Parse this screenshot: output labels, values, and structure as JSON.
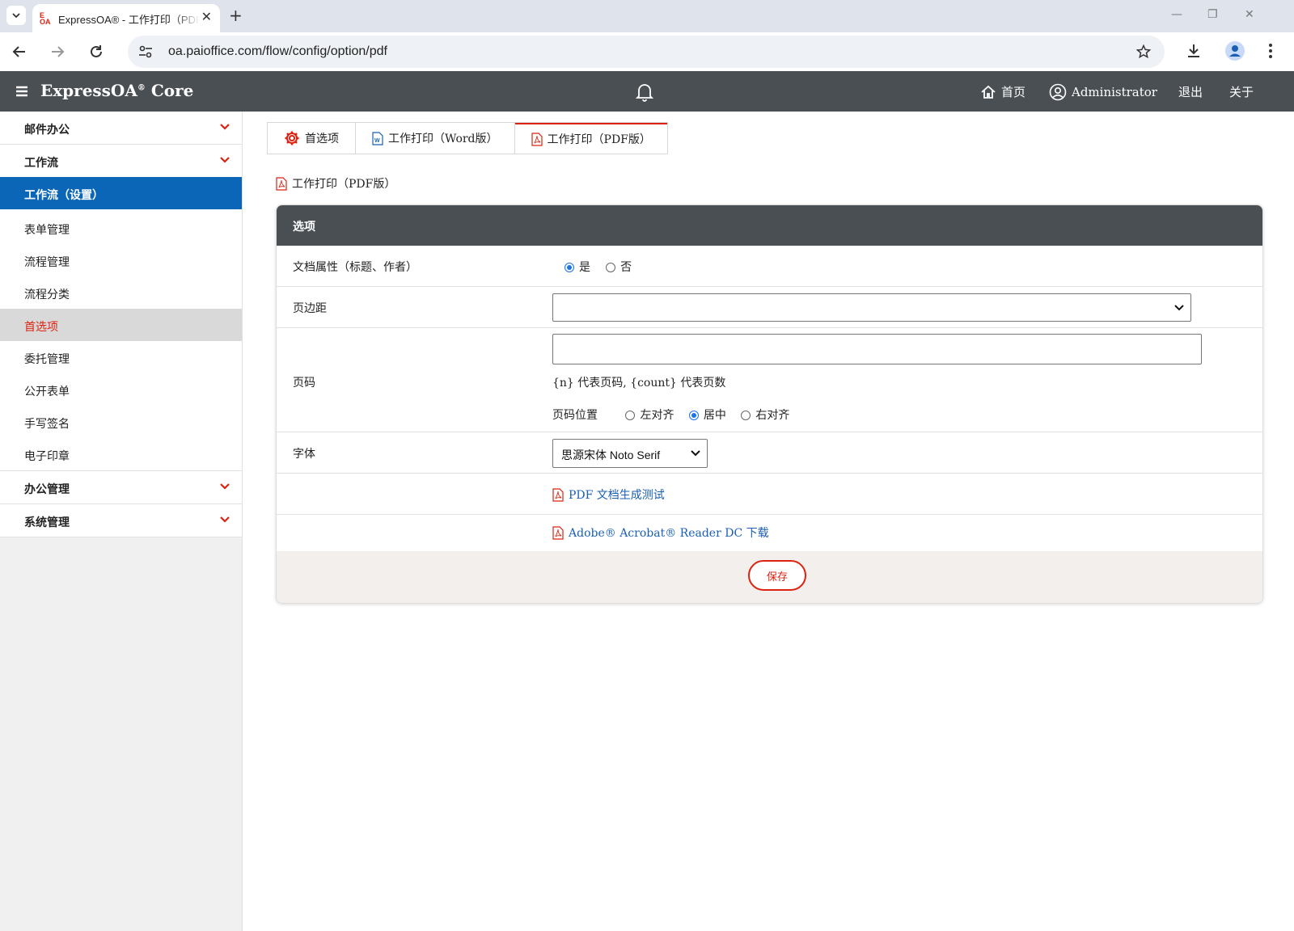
{
  "browser": {
    "tab_title": "ExpressOA® - 工作打印（PDF版）",
    "favicon_text": "E OA",
    "url": "oa.paioffice.com/flow/config/option/pdf"
  },
  "header": {
    "brand": "ExpressOA",
    "brand_sup": "®",
    "brand_suffix": " Core",
    "home": "首页",
    "user": "Administrator",
    "logout": "退出",
    "about": "关于"
  },
  "sidebar": {
    "group_mail": "邮件办公",
    "group_workflow": "工作流",
    "active": "工作流（设置）",
    "items": [
      "表单管理",
      "流程管理",
      "流程分类",
      "首选项",
      "委托管理",
      "公开表单",
      "手写签名",
      "电子印章"
    ],
    "current_index": 3,
    "group_office": "办公管理",
    "group_system": "系统管理"
  },
  "tabs": [
    "首选项",
    "工作打印（Word版）",
    "工作打印（PDF版）"
  ],
  "page_title": "工作打印（PDF版）",
  "panel": {
    "title": "选项",
    "doc_props_label": "文档属性（标题、作者）",
    "doc_props_yes": "是",
    "doc_props_no": "否",
    "doc_props_value": "是",
    "margin_label": "页边距",
    "margin_value": "",
    "pagenum_label": "页码",
    "pagenum_value": "",
    "pagenum_hint": "{n} 代表页码, {count} 代表页数",
    "pagepos_label": "页码位置",
    "pagepos_options": [
      "左对齐",
      "居中",
      "右对齐"
    ],
    "pagepos_value": "居中",
    "font_label": "字体",
    "font_value": "思源宋体 Noto Serif",
    "link_test": "PDF 文档生成测试",
    "link_adobe": "Adobe® Acrobat® Reader DC 下载",
    "save": "保存"
  },
  "colors": {
    "header_bg": "#4a4f54",
    "active_blue": "#0b66b8",
    "accent_red": "#dd2211",
    "link_blue": "#1a5fb4"
  }
}
